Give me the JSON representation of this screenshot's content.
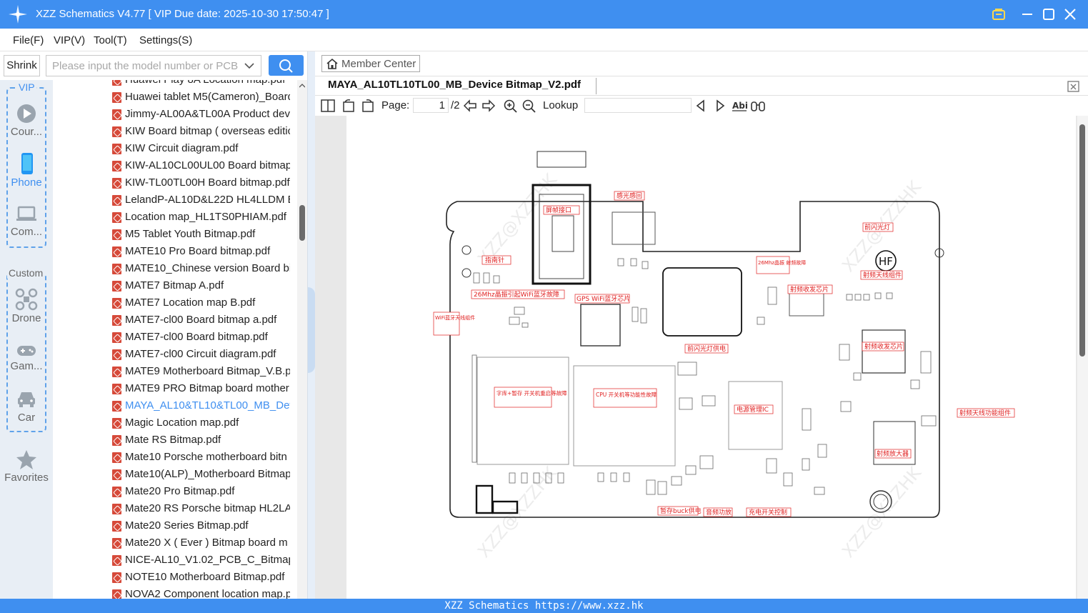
{
  "window": {
    "title": "XZZ Schematics V4.77 [ VIP Due date: 2025-10-30 17:50:47 ]",
    "icons": [
      "logo-icon",
      "vip-icon",
      "minimize-icon",
      "maximize-icon",
      "close-icon"
    ]
  },
  "menu": [
    "File(F)",
    "VIP(V)",
    "Tool(T)",
    "Settings(S)"
  ],
  "search": {
    "shrink_label": "Shrink",
    "placeholder": "Please input the model number or PCB"
  },
  "sidebar": {
    "vip_label": "VIP",
    "custom_label": "Custom",
    "vip_items": [
      {
        "label": "Cour...",
        "icon": "play-icon"
      },
      {
        "label": "Phone",
        "icon": "phone-icon",
        "active": true
      },
      {
        "label": "Com...",
        "icon": "laptop-icon"
      }
    ],
    "custom_items": [
      {
        "label": "Drone",
        "icon": "drone-icon"
      },
      {
        "label": "Gam...",
        "icon": "gamepad-icon"
      },
      {
        "label": "Car",
        "icon": "car-icon"
      }
    ],
    "favorites_label": "Favorites"
  },
  "files": [
    "Huawei Play 8A Location map.pdf",
    "Huawei tablet M5(Cameron)_Board",
    "Jimmy-AL00A&TL00A Product dev",
    "KIW Board bitmap ( overseas editic",
    "KIW Circuit diagram.pdf",
    "KIW-AL10CL00UL00 Board bitmap.",
    "KIW-TL00TL00H Board bitmap.pdf",
    "LelandP-AL10D&L22D HL4LLDM B",
    "Location map_HL1TS0PHIAM.pdf",
    "M5 Tablet Youth Bitmap.pdf",
    "MATE10 Pro Board bitmap.pdf",
    "MATE10_Chinese version Board bit",
    "MATE7 Bitmap A.pdf",
    "MATE7 Location map B.pdf",
    "MATE7-cl00 Board bitmap a.pdf",
    "MATE7-cl00 Board bitmap.pdf",
    "MATE7-cl00 Circuit diagram.pdf",
    "MATE9 Motherboard Bitmap_V.B.p",
    "MATE9 PRO Bitmap board mother",
    "MAYA_AL10&TL10&TL00_MB_Devi",
    "Magic Location map.pdf",
    "Mate RS Bitmap.pdf",
    "Mate10 Porsche motherboard bitn",
    "Mate10(ALP)_Motherboard Bitmap",
    "Mate20 Pro Bitmap.pdf",
    "Mate20 RS Porsche bitmap HL2LA'",
    "Mate20 Series Bitmap.pdf",
    "Mate20 X ( Ever ) Bitmap board m",
    "NICE-AL10_V1.02_PCB_C_Bitmap(1(",
    "NOTE10 Motherboard Bitmap.pdf",
    "NOVA2 Component location map.p"
  ],
  "active_file_index": 19,
  "viewer": {
    "member_center": "Member Center",
    "doc_tab": "MAYA_AL10TL10TL00_MB_Device Bitmap_V2.pdf",
    "page_label": "Page:",
    "page_current": "1",
    "page_total": "/2",
    "lookup_label": "Lookup"
  },
  "schematic_labels": {
    "hf": "HF",
    "camera_port": "屏帧接口",
    "light_sensor": "感光感回",
    "flash": "前闪光灯",
    "ant_label": "指南针",
    "wifi_26mhz": "26Mhz晶振引起WiFi蓝牙故障",
    "gps_wifi": "GPS WiFi蓝牙芯片",
    "wifi_ant": "WiFi蓝牙天线组件",
    "xtal_26mhz": "26Mhz晶振 射频故障",
    "rf_transceiver": "射频收发芯片",
    "rf_ant": "射频天线组件",
    "rf_tx_chip": "射频收发芯片",
    "flash_power": "前闪光灯供电",
    "storage": "字库+暂存 开关机重启等故障",
    "cpu": "CPU 开关机等功能性故障",
    "pmic": "电源管理IC",
    "rf_pa": "射频放大器",
    "rf_ant_module": "射频天线功能组件",
    "buck": "暂存buck供电",
    "audio": "音频功放",
    "charge": "充电开关控制",
    "watermark": "XZZ@XZZHK"
  },
  "statusbar": "XZZ Schematics https://www.xzz.hk",
  "colors": {
    "accent": "#3f8ff0",
    "pdf_red": "#d64a3a",
    "annotation_red": "#e02020"
  }
}
